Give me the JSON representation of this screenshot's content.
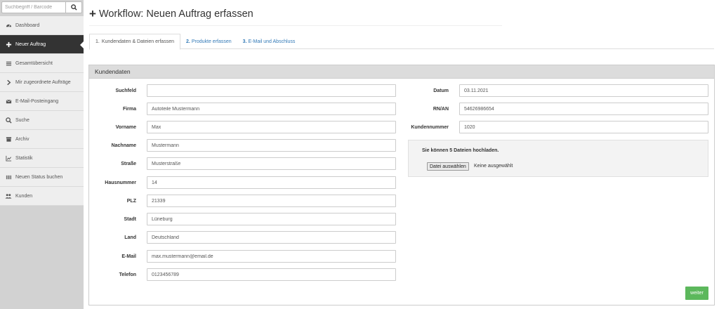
{
  "sidebar": {
    "search": {
      "placeholder": "Suchbegriff / Barcode"
    },
    "items": [
      {
        "label": "Dashboard",
        "icon": "dashboard-icon"
      },
      {
        "label": "Neuer Auftrag",
        "icon": "plus-icon",
        "active": true
      },
      {
        "label": "Gesamtübersicht",
        "icon": "list-icon"
      },
      {
        "label": "Mir zugeordnete Aufträge",
        "icon": "chevron-right-icon"
      },
      {
        "label": "E-Mail-Posteingang",
        "icon": "envelope-icon"
      },
      {
        "label": "Suche",
        "icon": "search-icon"
      },
      {
        "label": "Archiv",
        "icon": "archive-icon"
      },
      {
        "label": "Statistik",
        "icon": "chart-icon"
      },
      {
        "label": "Neuen Status buchen",
        "icon": "barcode-icon"
      },
      {
        "label": "Kunden",
        "icon": "users-icon"
      }
    ]
  },
  "header": {
    "title": "Workflow: Neuen Auftrag erfassen"
  },
  "tabs": [
    {
      "num": "1.",
      "label": "Kundendaten & Dateien erfassen",
      "active": true
    },
    {
      "num": "2.",
      "label": "Produkte erfassen"
    },
    {
      "num": "3.",
      "label": "E-Mail und Abschluss"
    }
  ],
  "panel": {
    "title": "Kundendaten",
    "left_fields": [
      {
        "label": "Suchfeld",
        "value": ""
      },
      {
        "label": "Firma",
        "value": "Autoteile Mustermann"
      },
      {
        "label": "Vorname",
        "value": "Max"
      },
      {
        "label": "Nachname",
        "value": "Mustermann"
      },
      {
        "label": "Straße",
        "value": "Musterstraße"
      },
      {
        "label": "Hausnummer",
        "value": "14"
      },
      {
        "label": "PLZ",
        "value": "21339"
      },
      {
        "label": "Stadt",
        "value": "Lüneburg"
      },
      {
        "label": "Land",
        "value": "Deutschland"
      },
      {
        "label": "E-Mail",
        "value": "max.mustermann@email.de"
      },
      {
        "label": "Telefon",
        "value": "0123456789"
      }
    ],
    "right_fields": [
      {
        "label": "Datum",
        "value": "03.11.2021"
      },
      {
        "label": "RN/AN",
        "value": "54626986654"
      },
      {
        "label": "Kundennummer",
        "value": "1020"
      }
    ],
    "upload": {
      "title": "Sie können 5 Dateien hochladen.",
      "button_label": "Datei auswählen",
      "status": "Keine ausgewählt"
    },
    "next_label": "weiter"
  },
  "colors": {
    "sidebar_active": "#333333",
    "link": "#337ab7",
    "next_button": "#5cb85c"
  }
}
